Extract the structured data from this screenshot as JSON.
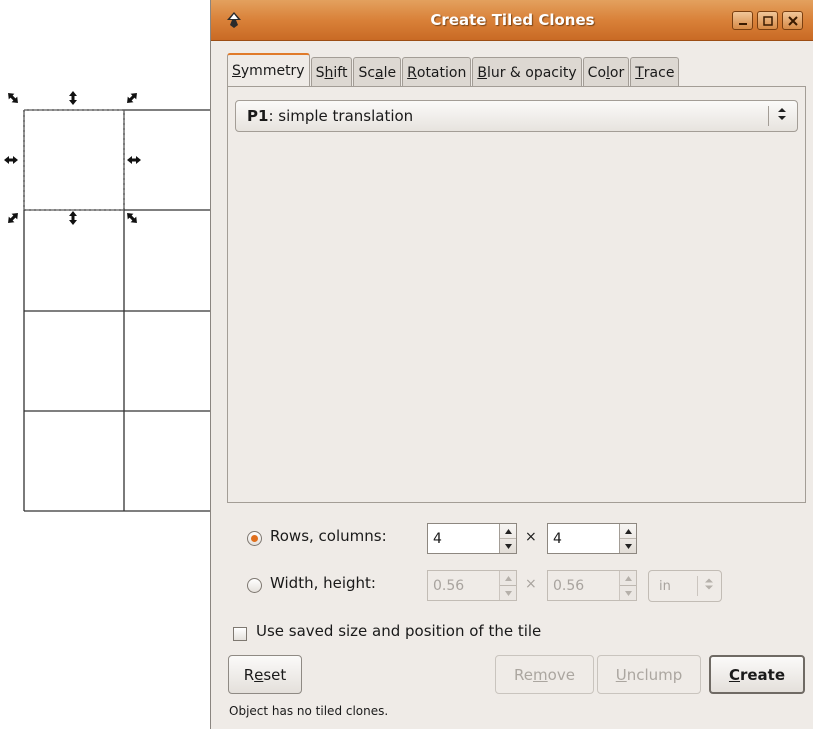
{
  "window": {
    "title": "Create Tiled Clones",
    "buttons": [
      "minimize",
      "maximize",
      "close"
    ]
  },
  "tabs": [
    {
      "label": "Symmetry",
      "mnemonic_index": 0,
      "active": true
    },
    {
      "label": "Shift",
      "mnemonic_index": 1,
      "active": false
    },
    {
      "label": "Scale",
      "mnemonic_index": 2,
      "active": false
    },
    {
      "label": "Rotation",
      "mnemonic_index": 0,
      "active": false
    },
    {
      "label": "Blur & opacity",
      "mnemonic_index": 0,
      "active": false
    },
    {
      "label": "Color",
      "mnemonic_index": 2,
      "active": false
    },
    {
      "label": "Trace",
      "mnemonic_index": 0,
      "active": false
    }
  ],
  "symmetry": {
    "selected_code": "P1",
    "selected_rest": ": simple translation"
  },
  "rows_columns": {
    "label": "Rows, columns:",
    "checked": true,
    "rows": "4",
    "columns": "4",
    "separator": "×"
  },
  "width_height": {
    "label": "Width, height:",
    "checked": false,
    "width": "0.56",
    "height": "0.56",
    "separator": "×",
    "unit": "in"
  },
  "use_saved": {
    "label": "Use saved size and position of the tile",
    "checked": false
  },
  "buttons": {
    "reset": "Reset",
    "remove": "Remove",
    "unclump": "Unclump",
    "create": "Create"
  },
  "status": "Object has no tiled clones.",
  "colors": {
    "titlebar": "#d98139",
    "accent": "#e0701e",
    "dialog_bg": "#efebe7"
  },
  "icons": [
    "inkscape-app-icon",
    "minimize-icon",
    "maximize-icon",
    "close-icon",
    "resize-arrow-icon"
  ]
}
